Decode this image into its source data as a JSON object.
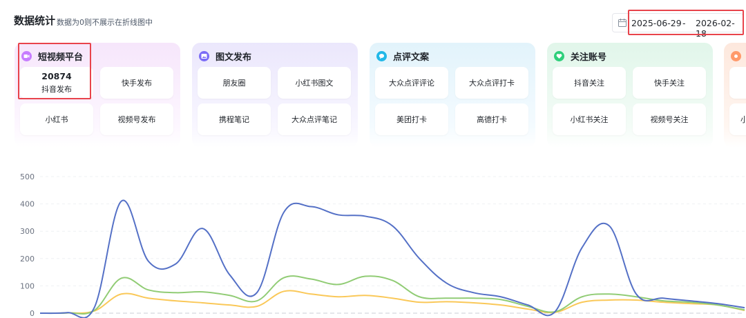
{
  "header": {
    "title": "数据统计",
    "subtitle": "数据为0则不展示在折线图中"
  },
  "date_range": {
    "start": "2025-06-29",
    "separator": "-",
    "end": "2026-02-18"
  },
  "colors": {
    "highlight": "#e8434b",
    "series_blue": "#5470c6",
    "series_green": "#91cc75",
    "series_yellow": "#fac858"
  },
  "cards": [
    {
      "title": "短视频平台",
      "icon": "video-icon",
      "color": "#c77dff",
      "tiles": [
        {
          "value": "20874",
          "label": "抖音发布"
        },
        {
          "label": "快手发布"
        },
        {
          "label": "小红书"
        },
        {
          "label": "视频号发布"
        }
      ]
    },
    {
      "title": "图文发布",
      "icon": "image-icon",
      "color": "#7b6cf6",
      "tiles": [
        {
          "label": "朋友圈"
        },
        {
          "label": "小红书图文"
        },
        {
          "label": "携程笔记"
        },
        {
          "label": "大众点评笔记"
        }
      ]
    },
    {
      "title": "点评文案",
      "icon": "comment-icon",
      "color": "#22b8e8",
      "tiles": [
        {
          "label": "大众点评评论"
        },
        {
          "label": "大众点评打卡"
        },
        {
          "label": "美团打卡"
        },
        {
          "label": "高德打卡"
        }
      ]
    },
    {
      "title": "关注账号",
      "icon": "heart-icon",
      "color": "#2ecf7a",
      "tiles": [
        {
          "label": "抖音关注"
        },
        {
          "label": "快手关注"
        },
        {
          "label": "小红书关注"
        },
        {
          "label": "视频号关注"
        }
      ]
    },
    {
      "title": "",
      "icon": "circle-icon",
      "color": "#ff9a6b",
      "tiles": [
        {
          "label": ""
        },
        {
          "label": "小"
        }
      ]
    }
  ],
  "chart_data": {
    "type": "line",
    "ylim": [
      0,
      500
    ],
    "yticks": [
      0,
      100,
      200,
      300,
      400,
      500
    ],
    "x": [
      0,
      1,
      2,
      3,
      4,
      5,
      6,
      7,
      8,
      9,
      10,
      11,
      12,
      13,
      14,
      15,
      16,
      17,
      18,
      19,
      20,
      21,
      22,
      23,
      24,
      25,
      26
    ],
    "series": [
      {
        "color": "#5470c6",
        "values": [
          0,
          2,
          20,
          410,
          190,
          180,
          310,
          140,
          75,
          370,
          390,
          360,
          355,
          320,
          200,
          110,
          75,
          60,
          30,
          5,
          240,
          320,
          70,
          55,
          45,
          35,
          20
        ]
      },
      {
        "color": "#91cc75",
        "values": [
          0,
          1,
          10,
          128,
          85,
          75,
          78,
          65,
          45,
          130,
          125,
          105,
          135,
          120,
          60,
          55,
          55,
          50,
          25,
          5,
          60,
          70,
          60,
          45,
          40,
          30,
          12
        ]
      },
      {
        "color": "#fac858",
        "values": [
          0,
          1,
          8,
          70,
          55,
          45,
          38,
          30,
          25,
          80,
          70,
          60,
          65,
          55,
          40,
          42,
          38,
          30,
          15,
          3,
          40,
          48,
          48,
          40,
          35,
          30,
          10
        ]
      }
    ]
  }
}
